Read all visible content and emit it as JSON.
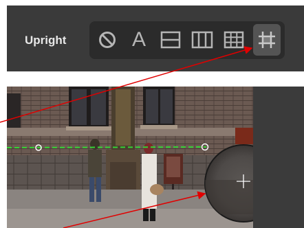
{
  "toolbar": {
    "label": "Upright",
    "buttons": [
      {
        "name": "off-button",
        "icon": "circle-slash-icon"
      },
      {
        "name": "auto-button",
        "icon": "letter-a-icon",
        "glyph": "A"
      },
      {
        "name": "level-button",
        "icon": "horizontal-split-icon"
      },
      {
        "name": "vertical-button",
        "icon": "vertical-lines-icon"
      },
      {
        "name": "full-button",
        "icon": "grid-icon"
      },
      {
        "name": "guided-button",
        "icon": "crop-crosshair-icon",
        "active": true
      }
    ]
  },
  "colors": {
    "toolbar_bg": "#3a3a3a",
    "button_group_bg": "#2b2b2b",
    "active_button_bg": "#545454",
    "icon": "#b5b5b5",
    "guide_line": "#35d335",
    "callout_arrow": "#e00000"
  }
}
